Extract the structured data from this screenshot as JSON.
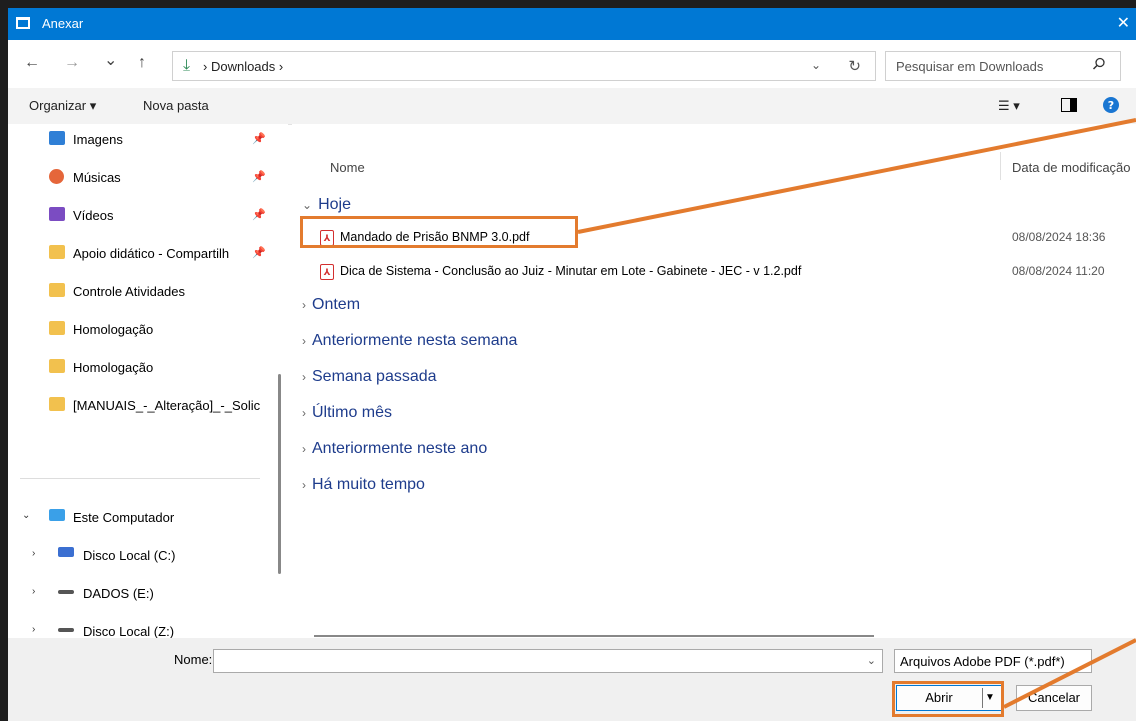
{
  "window": {
    "title": "Anexar",
    "close_glyph": "✕"
  },
  "nav": {
    "back": "←",
    "forward": "→",
    "recent": "⌄",
    "up": "↑",
    "breadcrumb": [
      "Downloads"
    ],
    "refresh": "↻",
    "search_placeholder": "Pesquisar em Downloads"
  },
  "toolbar": {
    "organize": "Organizar ▾",
    "new_folder": "Nova pasta",
    "view": "☰ ▾"
  },
  "sidebar": {
    "items": [
      {
        "label": "Imagens",
        "icon": "images-icon",
        "color": "#2f7fd6",
        "pinned": true
      },
      {
        "label": "Músicas",
        "icon": "music-icon",
        "color": "#e5663a",
        "pinned": true
      },
      {
        "label": "Vídeos",
        "icon": "videos-icon",
        "color": "#7b4cc2",
        "pinned": true
      },
      {
        "label": "Apoio didático - Compartilh",
        "icon": "folder-icon",
        "color": "#f2c14e",
        "pinned": true
      },
      {
        "label": "Controle Atividades",
        "icon": "folder-icon",
        "color": "#f2c14e",
        "pinned": false
      },
      {
        "label": "Homologação",
        "icon": "folder-icon",
        "color": "#f2c14e",
        "pinned": false
      },
      {
        "label": "Homologação",
        "icon": "folder-icon",
        "color": "#f2c14e",
        "pinned": false
      },
      {
        "label": "[MANUAIS_-_Alteração]_-_Solic",
        "icon": "folder-icon",
        "color": "#f2c14e",
        "pinned": false
      }
    ],
    "computer": {
      "label": "Este Computador",
      "drives": [
        "Disco Local (C:)",
        "DADOS (E:)",
        "Disco Local (Z:)"
      ]
    }
  },
  "content": {
    "columns": {
      "name": "Nome",
      "date": "Data de modificação"
    },
    "groups": [
      {
        "label": "Hoje",
        "expanded": true,
        "files": [
          {
            "name": "Mandado de Prisão BNMP 3.0.pdf",
            "date": "08/08/2024 18:36",
            "highlighted": true
          },
          {
            "name": "Dica de Sistema - Conclusão ao Juiz - Minutar em Lote - Gabinete - JEC - v 1.2.pdf",
            "date": "08/08/2024 11:20",
            "highlighted": false
          }
        ]
      },
      {
        "label": "Ontem",
        "expanded": false
      },
      {
        "label": "Anteriormente nesta semana",
        "expanded": false
      },
      {
        "label": "Semana passada",
        "expanded": false
      },
      {
        "label": "Último mês",
        "expanded": false
      },
      {
        "label": "Anteriormente neste ano",
        "expanded": false
      },
      {
        "label": "Há muito tempo",
        "expanded": false
      }
    ]
  },
  "bottom": {
    "name_label": "Nome:",
    "name_value": "",
    "filter": "Arquivos Adobe PDF (*.pdf*)",
    "open": "Abrir",
    "cancel": "Cancelar"
  },
  "colors": {
    "accent": "#0078d4",
    "highlight": "#e37b2e",
    "group_text": "#1e3c8c",
    "pdf_red": "#d32f2f"
  }
}
